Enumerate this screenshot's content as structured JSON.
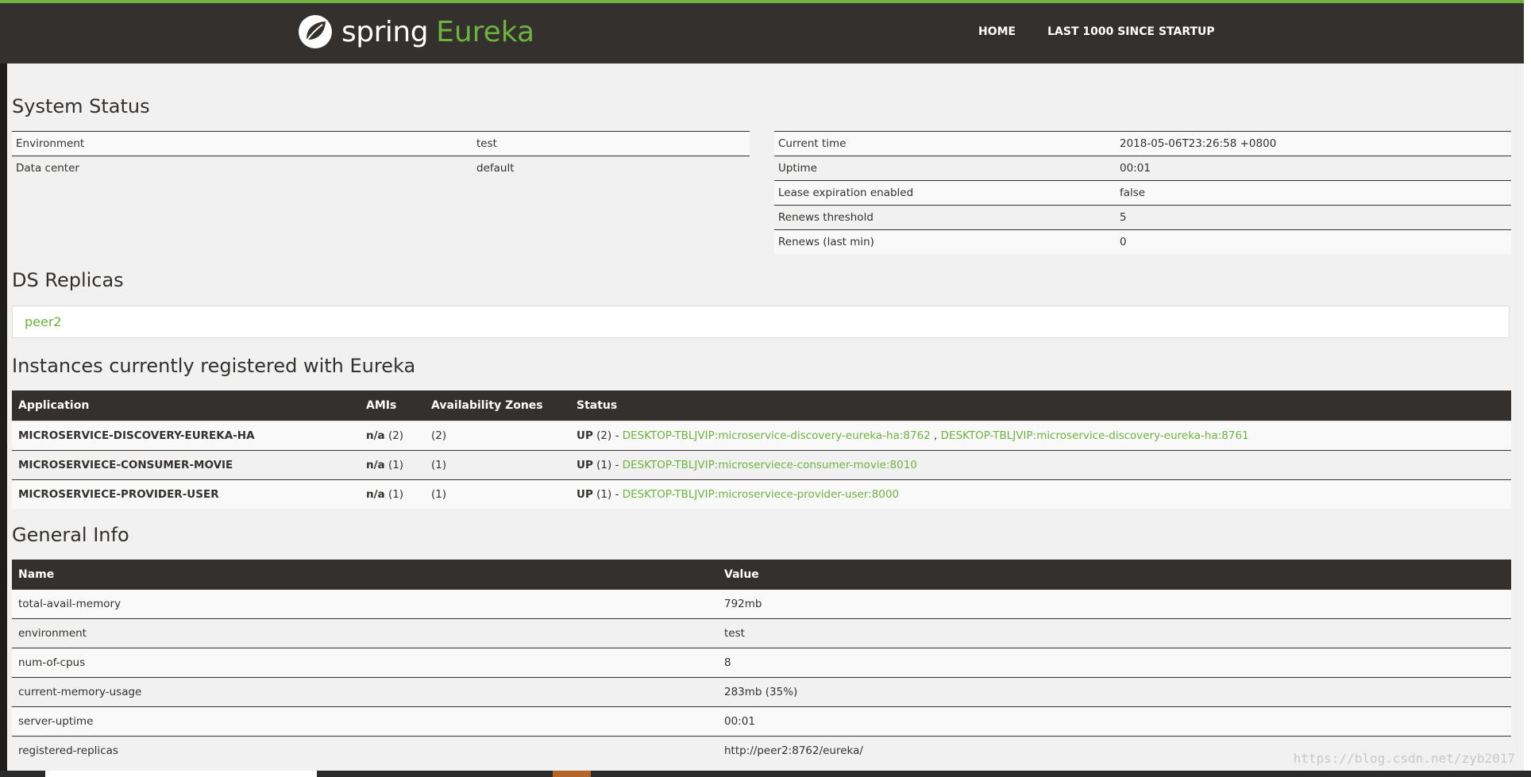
{
  "brand": {
    "spring": "spring",
    "eureka": "Eureka"
  },
  "nav": {
    "home": "HOME",
    "last": "LAST 1000 SINCE STARTUP"
  },
  "system_status": {
    "title": "System Status",
    "left": [
      {
        "label": "Environment",
        "value": "test"
      },
      {
        "label": "Data center",
        "value": "default"
      }
    ],
    "right": [
      {
        "label": "Current time",
        "value": "2018-05-06T23:26:58 +0800"
      },
      {
        "label": "Uptime",
        "value": "00:01"
      },
      {
        "label": "Lease expiration enabled",
        "value": "false"
      },
      {
        "label": "Renews threshold",
        "value": "5"
      },
      {
        "label": "Renews (last min)",
        "value": "0"
      }
    ]
  },
  "ds_replicas": {
    "title": "DS Replicas",
    "items": [
      "peer2"
    ]
  },
  "instances": {
    "title": "Instances currently registered with Eureka",
    "headers": [
      "Application",
      "AMIs",
      "Availability Zones",
      "Status"
    ],
    "rows": [
      {
        "app": "MICROSERVICE-DISCOVERY-EUREKA-HA",
        "ami": "n/a",
        "ami_count": "(2)",
        "zones": "(2)",
        "status": "UP",
        "status_count": "(2) -",
        "links": [
          "DESKTOP-TBLJVIP:microservice-discovery-eureka-ha:8762",
          "DESKTOP-TBLJVIP:microservice-discovery-eureka-ha:8761"
        ]
      },
      {
        "app": "MICROSERVIECE-CONSUMER-MOVIE",
        "ami": "n/a",
        "ami_count": "(1)",
        "zones": "(1)",
        "status": "UP",
        "status_count": "(1) -",
        "links": [
          "DESKTOP-TBLJVIP:microserviece-consumer-movie:8010"
        ]
      },
      {
        "app": "MICROSERVIECE-PROVIDER-USER",
        "ami": "n/a",
        "ami_count": "(1)",
        "zones": "(1)",
        "status": "UP",
        "status_count": "(1) -",
        "links": [
          "DESKTOP-TBLJVIP:microserviece-provider-user:8000"
        ]
      }
    ]
  },
  "general_info": {
    "title": "General Info",
    "headers": [
      "Name",
      "Value"
    ],
    "rows": [
      {
        "name": "total-avail-memory",
        "value": "792mb"
      },
      {
        "name": "environment",
        "value": "test"
      },
      {
        "name": "num-of-cpus",
        "value": "8"
      },
      {
        "name": "current-memory-usage",
        "value": "283mb (35%)"
      },
      {
        "name": "server-uptime",
        "value": "00:01"
      },
      {
        "name": "registered-replicas",
        "value": "http://peer2:8762/eureka/"
      }
    ]
  },
  "watermark": "https://blog.csdn.net/zyb2017",
  "colors": {
    "brand_green": "#6db33f",
    "nav_bg": "#34302d"
  }
}
